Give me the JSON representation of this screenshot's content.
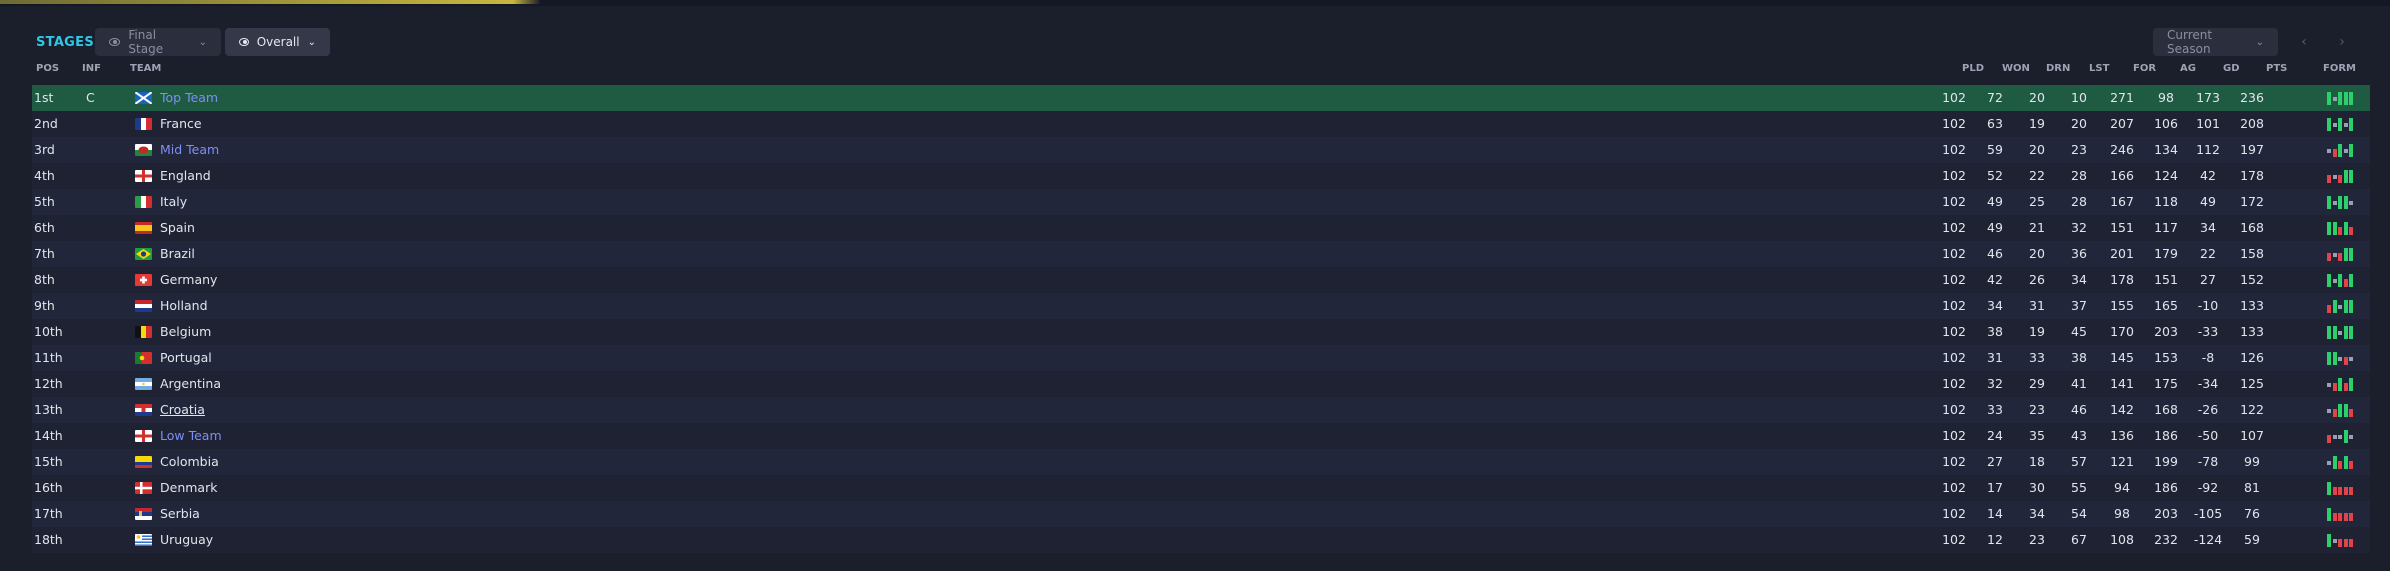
{
  "toolbar": {
    "stages_title": "STAGES",
    "final_stage_label": "Final Stage",
    "overall_label": "Overall",
    "season_label": "Current Season"
  },
  "columns": {
    "pos": "POS",
    "inf": "INF",
    "team": "TEAM",
    "pld": "PLD",
    "won": "WON",
    "drn": "DRN",
    "lst": "LST",
    "for": "FOR",
    "ag": "AG",
    "gd": "GD",
    "pts": "PTS",
    "form": "FORM"
  },
  "colors": {
    "win": "#2bd06a",
    "draw": "#9aa0b4",
    "loss": "#e0444a",
    "highlight": "#1f5a43",
    "accent": "#2ec8e6",
    "link": "#7d8ff4"
  },
  "rows": [
    {
      "pos": "1st",
      "inf": "C",
      "team": "Top Team",
      "flag": "scotland",
      "pld": "102",
      "won": "72",
      "drn": "20",
      "lst": "10",
      "for": "271",
      "ag": "98",
      "gd": "173",
      "pts": "236",
      "form": "WDWWW",
      "highlight": true,
      "link": true
    },
    {
      "pos": "2nd",
      "inf": "",
      "team": "France",
      "flag": "france",
      "pld": "102",
      "won": "63",
      "drn": "19",
      "lst": "20",
      "for": "207",
      "ag": "106",
      "gd": "101",
      "pts": "208",
      "form": "WDWDW"
    },
    {
      "pos": "3rd",
      "inf": "",
      "team": "Mid Team",
      "flag": "wales",
      "pld": "102",
      "won": "59",
      "drn": "20",
      "lst": "23",
      "for": "246",
      "ag": "134",
      "gd": "112",
      "pts": "197",
      "form": "DLWDW",
      "link": true
    },
    {
      "pos": "4th",
      "inf": "",
      "team": "England",
      "flag": "england",
      "pld": "102",
      "won": "52",
      "drn": "22",
      "lst": "28",
      "for": "166",
      "ag": "124",
      "gd": "42",
      "pts": "178",
      "form": "LDLWW"
    },
    {
      "pos": "5th",
      "inf": "",
      "team": "Italy",
      "flag": "italy",
      "pld": "102",
      "won": "49",
      "drn": "25",
      "lst": "28",
      "for": "167",
      "ag": "118",
      "gd": "49",
      "pts": "172",
      "form": "WDWWD"
    },
    {
      "pos": "6th",
      "inf": "",
      "team": "Spain",
      "flag": "spain",
      "pld": "102",
      "won": "49",
      "drn": "21",
      "lst": "32",
      "for": "151",
      "ag": "117",
      "gd": "34",
      "pts": "168",
      "form": "WWLWL"
    },
    {
      "pos": "7th",
      "inf": "",
      "team": "Brazil",
      "flag": "brazil",
      "pld": "102",
      "won": "46",
      "drn": "20",
      "lst": "36",
      "for": "201",
      "ag": "179",
      "gd": "22",
      "pts": "158",
      "form": "LDLWW"
    },
    {
      "pos": "8th",
      "inf": "",
      "team": "Germany",
      "flag": "switzerland",
      "pld": "102",
      "won": "42",
      "drn": "26",
      "lst": "34",
      "for": "178",
      "ag": "151",
      "gd": "27",
      "pts": "152",
      "form": "WDWLW"
    },
    {
      "pos": "9th",
      "inf": "",
      "team": "Holland",
      "flag": "holland",
      "pld": "102",
      "won": "34",
      "drn": "31",
      "lst": "37",
      "for": "155",
      "ag": "165",
      "gd": "-10",
      "pts": "133",
      "form": "LWDWW"
    },
    {
      "pos": "10th",
      "inf": "",
      "team": "Belgium",
      "flag": "belgium",
      "pld": "102",
      "won": "38",
      "drn": "19",
      "lst": "45",
      "for": "170",
      "ag": "203",
      "gd": "-33",
      "pts": "133",
      "form": "WWDWW"
    },
    {
      "pos": "11th",
      "inf": "",
      "team": "Portugal",
      "flag": "portugal",
      "pld": "102",
      "won": "31",
      "drn": "33",
      "lst": "38",
      "for": "145",
      "ag": "153",
      "gd": "-8",
      "pts": "126",
      "form": "WWDLD"
    },
    {
      "pos": "12th",
      "inf": "",
      "team": "Argentina",
      "flag": "argentina",
      "pld": "102",
      "won": "32",
      "drn": "29",
      "lst": "41",
      "for": "141",
      "ag": "175",
      "gd": "-34",
      "pts": "125",
      "form": "DLWLW"
    },
    {
      "pos": "13th",
      "inf": "",
      "team": "Croatia",
      "flag": "croatia",
      "pld": "102",
      "won": "33",
      "drn": "23",
      "lst": "46",
      "for": "142",
      "ag": "168",
      "gd": "-26",
      "pts": "122",
      "form": "DLWWL",
      "underline": true
    },
    {
      "pos": "14th",
      "inf": "",
      "team": "Low Team",
      "flag": "england",
      "pld": "102",
      "won": "24",
      "drn": "35",
      "lst": "43",
      "for": "136",
      "ag": "186",
      "gd": "-50",
      "pts": "107",
      "form": "LDDWD",
      "link": true
    },
    {
      "pos": "15th",
      "inf": "",
      "team": "Colombia",
      "flag": "colombia",
      "pld": "102",
      "won": "27",
      "drn": "18",
      "lst": "57",
      "for": "121",
      "ag": "199",
      "gd": "-78",
      "pts": "99",
      "form": "DWLWL"
    },
    {
      "pos": "16th",
      "inf": "",
      "team": "Denmark",
      "flag": "denmark",
      "pld": "102",
      "won": "17",
      "drn": "30",
      "lst": "55",
      "for": "94",
      "ag": "186",
      "gd": "-92",
      "pts": "81",
      "form": "WLLLL"
    },
    {
      "pos": "17th",
      "inf": "",
      "team": "Serbia",
      "flag": "serbia",
      "pld": "102",
      "won": "14",
      "drn": "34",
      "lst": "54",
      "for": "98",
      "ag": "203",
      "gd": "-105",
      "pts": "76",
      "form": "WLLLL"
    },
    {
      "pos": "18th",
      "inf": "",
      "team": "Uruguay",
      "flag": "uruguay",
      "pld": "102",
      "won": "12",
      "drn": "23",
      "lst": "67",
      "for": "108",
      "ag": "232",
      "gd": "-124",
      "pts": "59",
      "form": "WDLLL"
    }
  ]
}
